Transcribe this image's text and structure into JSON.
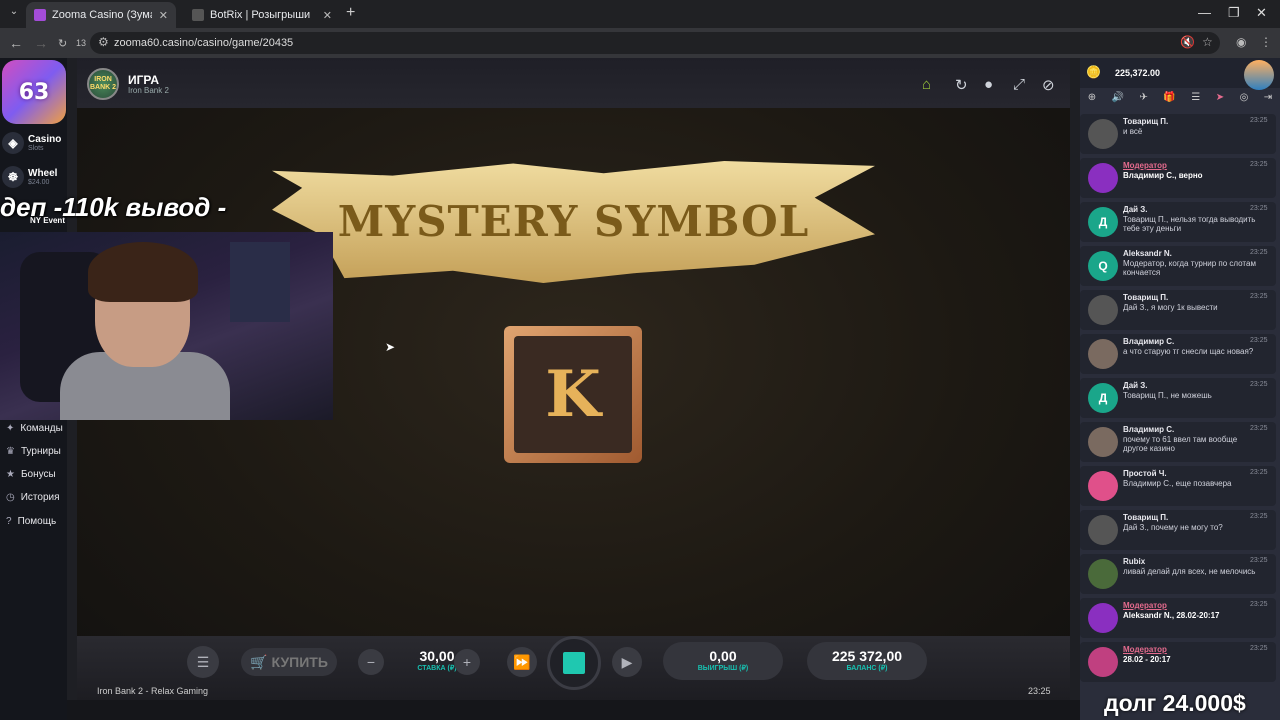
{
  "browser": {
    "tabs": [
      {
        "label": "Zooma Casino (Зума Казино",
        "fav": "#a34cd8"
      },
      {
        "label": "BotRix | Розыгрыши",
        "fav": "#444"
      }
    ],
    "url": "zooma60.casino/casino/game/20435",
    "counter": "13"
  },
  "sidebar": {
    "logo": "63",
    "casino": "Casino",
    "casino_sub": "Slots",
    "wheel": "Wheel",
    "wheel_sub": "$24.00",
    "ny": "NY Event",
    "menu": [
      {
        "icon": "✦",
        "label": "Команды"
      },
      {
        "icon": "♛",
        "label": "Турниры"
      },
      {
        "icon": "★",
        "label": "Бонусы"
      },
      {
        "icon": "◷",
        "label": "История"
      },
      {
        "icon": "?",
        "label": "Помощь"
      }
    ]
  },
  "overlay_text": "деп -110k вывод -",
  "game": {
    "icon_text": "IRON BANK 2",
    "title": "ИГРА",
    "subtitle": "Iron Bank 2",
    "banner": "MYSTERY SYMBOL",
    "symbol": "K",
    "buy": "КУПИТЬ",
    "stake": "30,00",
    "stake_label": "СТАВКА (₽)",
    "win": "0,00",
    "win_label": "ВЫИГРЫШ (₽)",
    "balance": "225 372,00",
    "balance_label": "БАЛАНС (₽)",
    "footer": "Iron Bank 2 - Relax Gaming",
    "time": "23:25"
  },
  "chat": {
    "balance": "225,372.00",
    "messages": [
      {
        "name": "Товарищ П.",
        "text": "и всё",
        "time": "23:25",
        "mod": false,
        "color": "#555"
      },
      {
        "name": "Модератор",
        "text": "Владимир С., верно",
        "time": "23:25",
        "mod": true,
        "color": "#8a2fc0",
        "bold": true
      },
      {
        "name": "Дай З.",
        "text": "Товарищ П., нельзя тогда выводить тебе эту деньги",
        "time": "23:25",
        "mod": false,
        "color": "#1aa68a",
        "letter": "Д"
      },
      {
        "name": "Aleksandr N.",
        "text": "Модератор, когда турнир по слотам кончается",
        "time": "23:25",
        "mod": false,
        "color": "#1aa68a",
        "letter": "Q"
      },
      {
        "name": "Товарищ П.",
        "text": "Дай З., я могу 1к вывести",
        "time": "23:25",
        "mod": false,
        "color": "#555"
      },
      {
        "name": "Владимир С.",
        "text": "а что старую тг снесли щас новая?",
        "time": "23:25",
        "mod": false,
        "color": "#7a6a60"
      },
      {
        "name": "Дай З.",
        "text": "Товарищ П., не можешь",
        "time": "23:25",
        "mod": false,
        "color": "#1aa68a",
        "letter": "Д"
      },
      {
        "name": "Владимир С.",
        "text": "почему то 61 ввел там вообще другое казино",
        "time": "23:25",
        "mod": false,
        "color": "#7a6a60"
      },
      {
        "name": "Простой Ч.",
        "text": "Владимир С., еще позавчера",
        "time": "23:25",
        "mod": false,
        "color": "#e0508a"
      },
      {
        "name": "Товарищ П.",
        "text": "Дай З., почему не могу то?",
        "time": "23:25",
        "mod": false,
        "color": "#555"
      },
      {
        "name": "Rubix",
        "text": "ливай делай для всех, не мелочись",
        "time": "23:25",
        "mod": false,
        "color": "#4a6a3a"
      },
      {
        "name": "Модератор",
        "text": "Aleksandr N., 28.02-20:17",
        "time": "23:25",
        "mod": true,
        "color": "#8a2fc0",
        "bold": true
      },
      {
        "name": "Модератор",
        "text": "28.02 - 20:17",
        "time": "23:25",
        "mod": true,
        "color": "#c04080",
        "bold": true
      }
    ]
  },
  "debt_text": "долг 24.000$"
}
